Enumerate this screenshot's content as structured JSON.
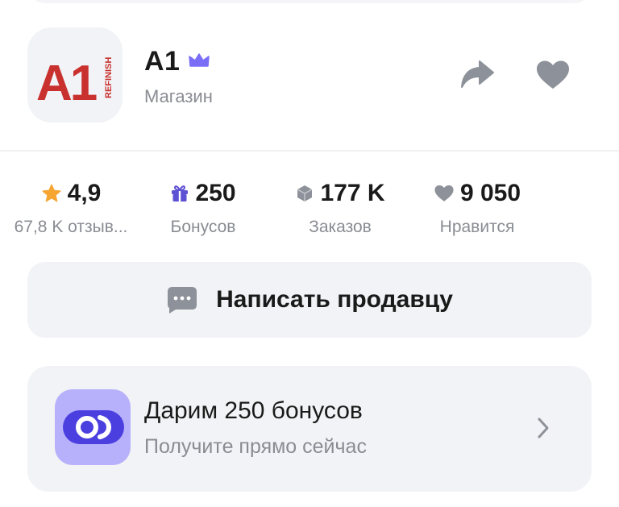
{
  "store": {
    "name": "A1",
    "type": "Магазин",
    "logo_text": "A1",
    "logo_subtext": "REFINISH"
  },
  "stats": [
    {
      "value": "4,9",
      "label": "67,8 K отзыв...",
      "icon": "star-icon"
    },
    {
      "value": "250",
      "label": "Бонусов",
      "icon": "gift-icon"
    },
    {
      "value": "177 K",
      "label": "Заказов",
      "icon": "box-icon"
    },
    {
      "value": "9 050",
      "label": "Нравится",
      "icon": "heart-icon"
    }
  ],
  "message_button": {
    "label": "Написать продавцу",
    "icon": "chat-icon"
  },
  "promo": {
    "title": "Дарим 250 бонусов",
    "subtitle": "Получите прямо сейчас",
    "icon": "bonus-toggle-icon"
  },
  "colors": {
    "star": "#f6a531",
    "gift": "#5e52d4",
    "crown": "#7b6ef6",
    "logo_red": "#c8312e",
    "icon_gray": "#8d9199",
    "muted_text": "#8a8c93",
    "card_bg": "#f2f3f6",
    "promo_icon_bg": "#b7b1fb",
    "promo_toggle": "#4b3fe0"
  }
}
